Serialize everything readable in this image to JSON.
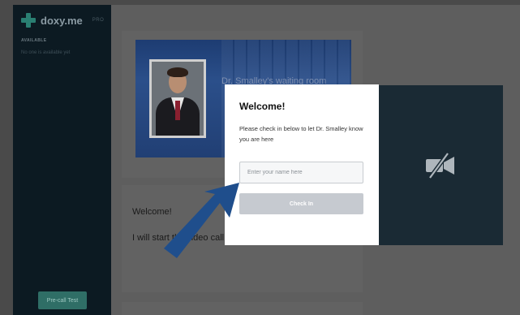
{
  "app": {
    "logo_text": "doxy.me",
    "plan_badge": "PRO"
  },
  "sidebar": {
    "status_label": "AVAILABLE",
    "status_text": "No one is available yet",
    "precall_button_label": "Pre-call Test"
  },
  "waiting_room": {
    "title": "Dr. Smalley's waiting room"
  },
  "welcome_card": {
    "title": "Welcome!",
    "body": "I will start the video call shortly."
  },
  "modal": {
    "title": "Welcome!",
    "message": "Please check in below to let Dr. Smalley know you are here",
    "name_input_placeholder": "Enter your name here",
    "name_input_value": "",
    "checkin_button_label": "Check In"
  },
  "video": {
    "status_icon": "camera-off-icon"
  },
  "annotation": {
    "icon": "arrow-pointer-icon",
    "color": "#1f4e8c"
  },
  "colors": {
    "sidebar_bg": "#0c1a22",
    "brand_teal": "#2a7f72",
    "overlay_dim": "#5e5e5e",
    "video_bg": "#1a2a34",
    "checkin_button_bg": "#c6cad0"
  }
}
